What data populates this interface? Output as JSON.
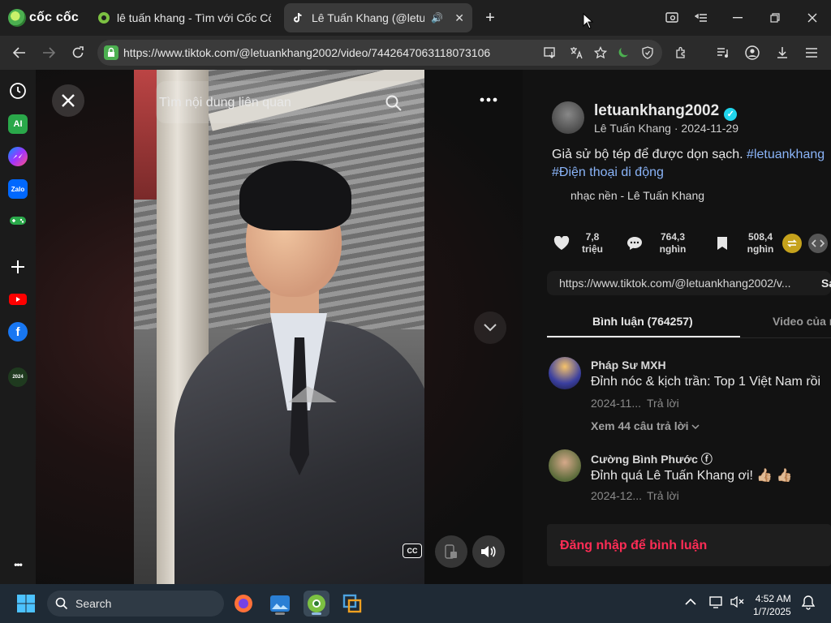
{
  "browser": {
    "brand": "cốc cốc",
    "tabs": [
      {
        "label": "lê tuấn khang - Tìm với Cốc Cốc"
      },
      {
        "label": "Lê Tuấn Khang (@letuank"
      }
    ],
    "new_tab_label": "+",
    "url": "https://www.tiktok.com/@letuankhang2002/video/7442647063118073106"
  },
  "sidebar": {
    "items": [
      {
        "icon": "history-icon"
      },
      {
        "icon": "ai-icon",
        "text": "AI"
      },
      {
        "icon": "messenger-icon"
      },
      {
        "icon": "zalo-icon",
        "text": "Zalo"
      },
      {
        "icon": "game-icon"
      },
      {
        "icon": "add-icon"
      },
      {
        "icon": "youtube-icon"
      },
      {
        "icon": "facebook-icon"
      },
      {
        "icon": "event-2024-icon",
        "text": "2024"
      }
    ],
    "more_label": "•••"
  },
  "video": {
    "search_placeholder": "Tìm nội dung liên quan",
    "cc_label": "CC"
  },
  "post": {
    "username": "letuankhang2002",
    "display_line": "Lê Tuấn Khang · 2024-11-29",
    "caption_text": "Giả sử bộ tép để được dọn sạch. ",
    "caption_tag1": "#letuankhang",
    "caption_tag2": "#Điện thoại di động",
    "music": "nhạc nền - Lê Tuấn Khang",
    "likes_1": "7,8",
    "likes_2": "triệu",
    "comments_1": "764,3",
    "comments_2": "nghìn",
    "saves_1": "508,4",
    "saves_2": "nghìn",
    "link": "https://www.tiktok.com/@letuankhang2002/v...",
    "link_action": "Sa",
    "tab_comments": "Bình luận (764257)",
    "tab_videos": "Video của n",
    "login_prompt": "Đăng nhập để bình luận"
  },
  "comments": [
    {
      "author": "Pháp Sư MXH",
      "text": "Đỉnh nóc & kịch trần: Top 1 Việt Nam rồi",
      "date": "2024-11...",
      "reply": "Trả lời",
      "view_replies": "Xem 44 câu trả lời"
    },
    {
      "author": "Cường Bình Phước",
      "author_badge": "ⓕ",
      "text": "Đỉnh quá Lê Tuấn Khang ơi! 👍🏼 👍🏼",
      "date": "2024-12...",
      "reply": "Trả lời"
    }
  ],
  "taskbar": {
    "search_label": "Search",
    "time": "4:52 AM",
    "date": "1/7/2025"
  },
  "colors": {
    "accent_red": "#fe2c55",
    "hashtag_blue": "#8ab4f8",
    "verified": "#20d5ec"
  }
}
